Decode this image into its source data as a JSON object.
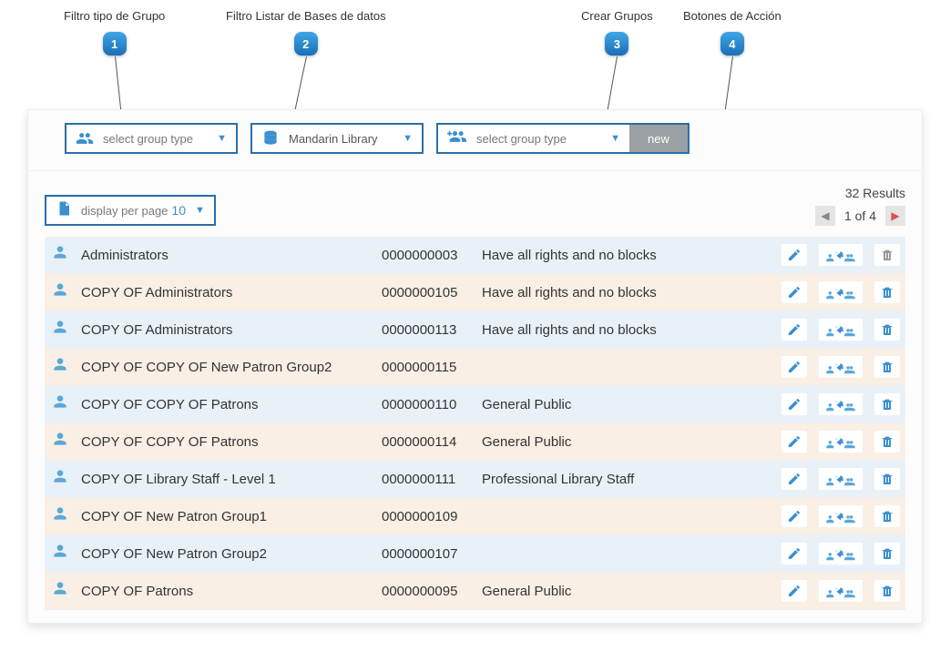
{
  "callouts": {
    "c1": {
      "label": "Filtro tipo de Grupo",
      "num": "1"
    },
    "c2": {
      "label": "Filtro Listar de Bases de datos",
      "num": "2"
    },
    "c3": {
      "label": "Crear Grupos",
      "num": "3"
    },
    "c4": {
      "label": "Botones de Acción",
      "num": "4"
    }
  },
  "toolbar": {
    "groupTypeFilter": "select group type",
    "databaseFilter": "Mandarin Library",
    "createGroupSelect": "select group type",
    "newButton": "new"
  },
  "subbar": {
    "displayPerPageLabel": "display per page",
    "displayPerPageValue": "10",
    "resultsCount": "32 Results",
    "pageText": "1 of 4"
  },
  "rows": [
    {
      "name": "Administrators",
      "id": "0000000003",
      "desc": "Have all rights and no blocks"
    },
    {
      "name": "COPY OF Administrators",
      "id": "0000000105",
      "desc": "Have all rights and no blocks"
    },
    {
      "name": "COPY OF Administrators",
      "id": "0000000113",
      "desc": "Have all rights and no blocks"
    },
    {
      "name": "COPY OF COPY OF New Patron Group2",
      "id": "0000000115",
      "desc": ""
    },
    {
      "name": "COPY OF COPY OF Patrons",
      "id": "0000000110",
      "desc": "General Public"
    },
    {
      "name": "COPY OF COPY OF Patrons",
      "id": "0000000114",
      "desc": "General Public"
    },
    {
      "name": "COPY OF Library Staff - Level 1",
      "id": "0000000111",
      "desc": "Professional Library Staff"
    },
    {
      "name": "COPY OF New Patron Group1",
      "id": "0000000109",
      "desc": ""
    },
    {
      "name": "COPY OF New Patron Group2",
      "id": "0000000107",
      "desc": ""
    },
    {
      "name": "COPY OF Patrons",
      "id": "0000000095",
      "desc": "General Public"
    }
  ]
}
